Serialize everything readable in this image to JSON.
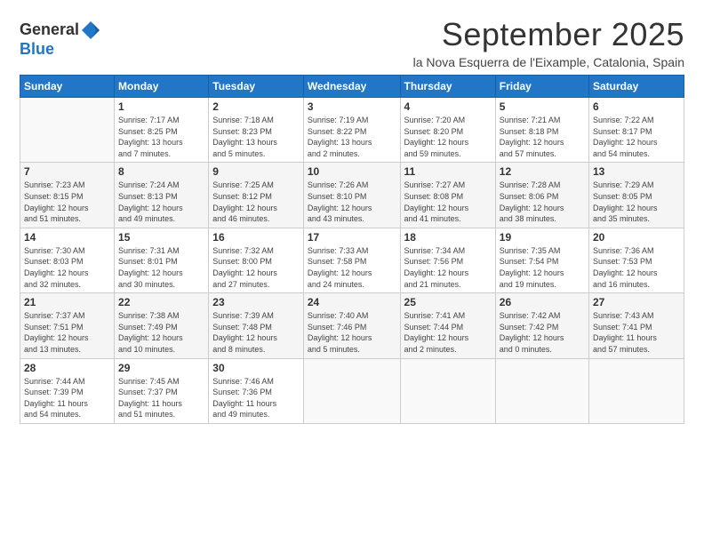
{
  "logo": {
    "general": "General",
    "blue": "Blue"
  },
  "header": {
    "month": "September 2025",
    "subtitle": "la Nova Esquerra de l'Eixample, Catalonia, Spain"
  },
  "days_of_week": [
    "Sunday",
    "Monday",
    "Tuesday",
    "Wednesday",
    "Thursday",
    "Friday",
    "Saturday"
  ],
  "weeks": [
    [
      {
        "day": "",
        "info": ""
      },
      {
        "day": "1",
        "info": "Sunrise: 7:17 AM\nSunset: 8:25 PM\nDaylight: 13 hours\nand 7 minutes."
      },
      {
        "day": "2",
        "info": "Sunrise: 7:18 AM\nSunset: 8:23 PM\nDaylight: 13 hours\nand 5 minutes."
      },
      {
        "day": "3",
        "info": "Sunrise: 7:19 AM\nSunset: 8:22 PM\nDaylight: 13 hours\nand 2 minutes."
      },
      {
        "day": "4",
        "info": "Sunrise: 7:20 AM\nSunset: 8:20 PM\nDaylight: 12 hours\nand 59 minutes."
      },
      {
        "day": "5",
        "info": "Sunrise: 7:21 AM\nSunset: 8:18 PM\nDaylight: 12 hours\nand 57 minutes."
      },
      {
        "day": "6",
        "info": "Sunrise: 7:22 AM\nSunset: 8:17 PM\nDaylight: 12 hours\nand 54 minutes."
      }
    ],
    [
      {
        "day": "7",
        "info": "Sunrise: 7:23 AM\nSunset: 8:15 PM\nDaylight: 12 hours\nand 51 minutes."
      },
      {
        "day": "8",
        "info": "Sunrise: 7:24 AM\nSunset: 8:13 PM\nDaylight: 12 hours\nand 49 minutes."
      },
      {
        "day": "9",
        "info": "Sunrise: 7:25 AM\nSunset: 8:12 PM\nDaylight: 12 hours\nand 46 minutes."
      },
      {
        "day": "10",
        "info": "Sunrise: 7:26 AM\nSunset: 8:10 PM\nDaylight: 12 hours\nand 43 minutes."
      },
      {
        "day": "11",
        "info": "Sunrise: 7:27 AM\nSunset: 8:08 PM\nDaylight: 12 hours\nand 41 minutes."
      },
      {
        "day": "12",
        "info": "Sunrise: 7:28 AM\nSunset: 8:06 PM\nDaylight: 12 hours\nand 38 minutes."
      },
      {
        "day": "13",
        "info": "Sunrise: 7:29 AM\nSunset: 8:05 PM\nDaylight: 12 hours\nand 35 minutes."
      }
    ],
    [
      {
        "day": "14",
        "info": "Sunrise: 7:30 AM\nSunset: 8:03 PM\nDaylight: 12 hours\nand 32 minutes."
      },
      {
        "day": "15",
        "info": "Sunrise: 7:31 AM\nSunset: 8:01 PM\nDaylight: 12 hours\nand 30 minutes."
      },
      {
        "day": "16",
        "info": "Sunrise: 7:32 AM\nSunset: 8:00 PM\nDaylight: 12 hours\nand 27 minutes."
      },
      {
        "day": "17",
        "info": "Sunrise: 7:33 AM\nSunset: 7:58 PM\nDaylight: 12 hours\nand 24 minutes."
      },
      {
        "day": "18",
        "info": "Sunrise: 7:34 AM\nSunset: 7:56 PM\nDaylight: 12 hours\nand 21 minutes."
      },
      {
        "day": "19",
        "info": "Sunrise: 7:35 AM\nSunset: 7:54 PM\nDaylight: 12 hours\nand 19 minutes."
      },
      {
        "day": "20",
        "info": "Sunrise: 7:36 AM\nSunset: 7:53 PM\nDaylight: 12 hours\nand 16 minutes."
      }
    ],
    [
      {
        "day": "21",
        "info": "Sunrise: 7:37 AM\nSunset: 7:51 PM\nDaylight: 12 hours\nand 13 minutes."
      },
      {
        "day": "22",
        "info": "Sunrise: 7:38 AM\nSunset: 7:49 PM\nDaylight: 12 hours\nand 10 minutes."
      },
      {
        "day": "23",
        "info": "Sunrise: 7:39 AM\nSunset: 7:48 PM\nDaylight: 12 hours\nand 8 minutes."
      },
      {
        "day": "24",
        "info": "Sunrise: 7:40 AM\nSunset: 7:46 PM\nDaylight: 12 hours\nand 5 minutes."
      },
      {
        "day": "25",
        "info": "Sunrise: 7:41 AM\nSunset: 7:44 PM\nDaylight: 12 hours\nand 2 minutes."
      },
      {
        "day": "26",
        "info": "Sunrise: 7:42 AM\nSunset: 7:42 PM\nDaylight: 12 hours\nand 0 minutes."
      },
      {
        "day": "27",
        "info": "Sunrise: 7:43 AM\nSunset: 7:41 PM\nDaylight: 11 hours\nand 57 minutes."
      }
    ],
    [
      {
        "day": "28",
        "info": "Sunrise: 7:44 AM\nSunset: 7:39 PM\nDaylight: 11 hours\nand 54 minutes."
      },
      {
        "day": "29",
        "info": "Sunrise: 7:45 AM\nSunset: 7:37 PM\nDaylight: 11 hours\nand 51 minutes."
      },
      {
        "day": "30",
        "info": "Sunrise: 7:46 AM\nSunset: 7:36 PM\nDaylight: 11 hours\nand 49 minutes."
      },
      {
        "day": "",
        "info": ""
      },
      {
        "day": "",
        "info": ""
      },
      {
        "day": "",
        "info": ""
      },
      {
        "day": "",
        "info": ""
      }
    ]
  ]
}
